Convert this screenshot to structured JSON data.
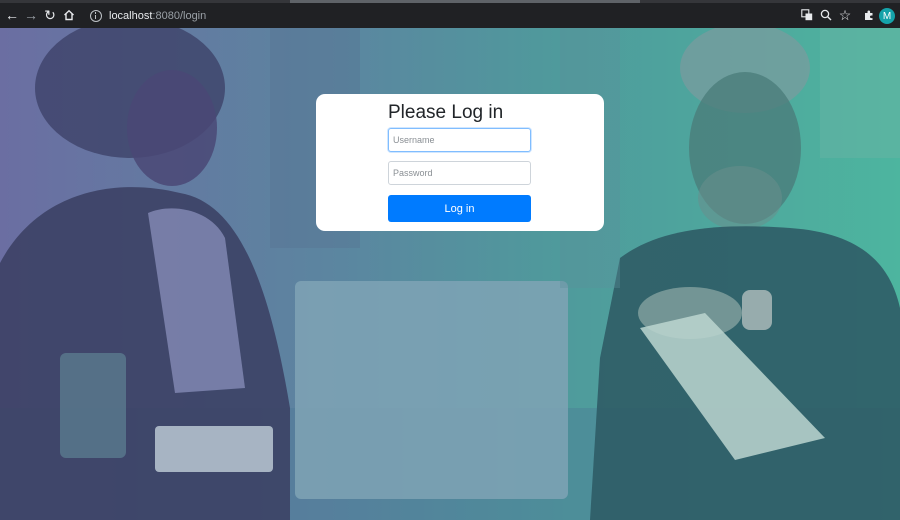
{
  "browser": {
    "url_host": "localhost",
    "url_rest": ":8080/login",
    "profile_initial": "M",
    "icons": [
      "back-arrow-icon",
      "forward-arrow-icon",
      "reload-icon",
      "home-icon",
      "info-icon",
      "translate-icon",
      "zoom-icon",
      "bookmark-star-icon",
      "extensions-icon"
    ]
  },
  "login": {
    "title": "Please Log in",
    "username_placeholder": "Username",
    "password_placeholder": "Password",
    "button_label": "Log in"
  },
  "colors": {
    "primary_button": "#007bff",
    "focus_border": "#80bdff",
    "overlay_left": "#6b6ea2",
    "overlay_right": "#4db59f"
  }
}
